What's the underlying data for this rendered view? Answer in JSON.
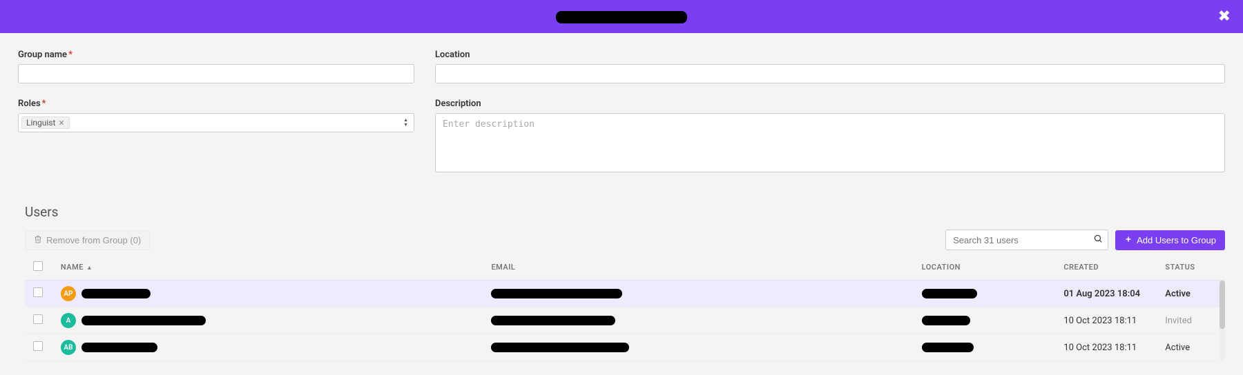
{
  "header": {
    "title": "",
    "close_aria": "Close"
  },
  "form": {
    "group_name": {
      "label": "Group name",
      "required": true,
      "value": ""
    },
    "location": {
      "label": "Location",
      "value": ""
    },
    "roles": {
      "label": "Roles",
      "required": true,
      "tags": [
        "Linguist"
      ]
    },
    "description": {
      "label": "Description",
      "placeholder": "Enter description",
      "value": ""
    }
  },
  "users": {
    "section_title": "Users",
    "remove_label": "Remove from Group (0)",
    "search_placeholder": "Search 31 users",
    "add_label": "Add Users to Group",
    "columns": {
      "name": "NAME",
      "email": "EMAIL",
      "location": "LOCATION",
      "created": "CREATED",
      "status": "STATUS"
    },
    "sort": {
      "column": "name",
      "dir": "asc"
    },
    "rows": [
      {
        "initials": "AP",
        "avatar_color": "#f39c12",
        "name": "",
        "email": "",
        "location": "",
        "created": "01 Aug 2023 18:04",
        "status": "Active",
        "selected": true
      },
      {
        "initials": "A",
        "avatar_color": "#1abc9c",
        "name": "",
        "email": "",
        "location": "",
        "created": "10 Oct 2023 18:11",
        "status": "Invited",
        "selected": false
      },
      {
        "initials": "AB",
        "avatar_color": "#1abc9c",
        "name": "",
        "email": "",
        "location": "",
        "created": "10 Oct 2023 18:11",
        "status": "Active",
        "selected": false
      }
    ]
  }
}
